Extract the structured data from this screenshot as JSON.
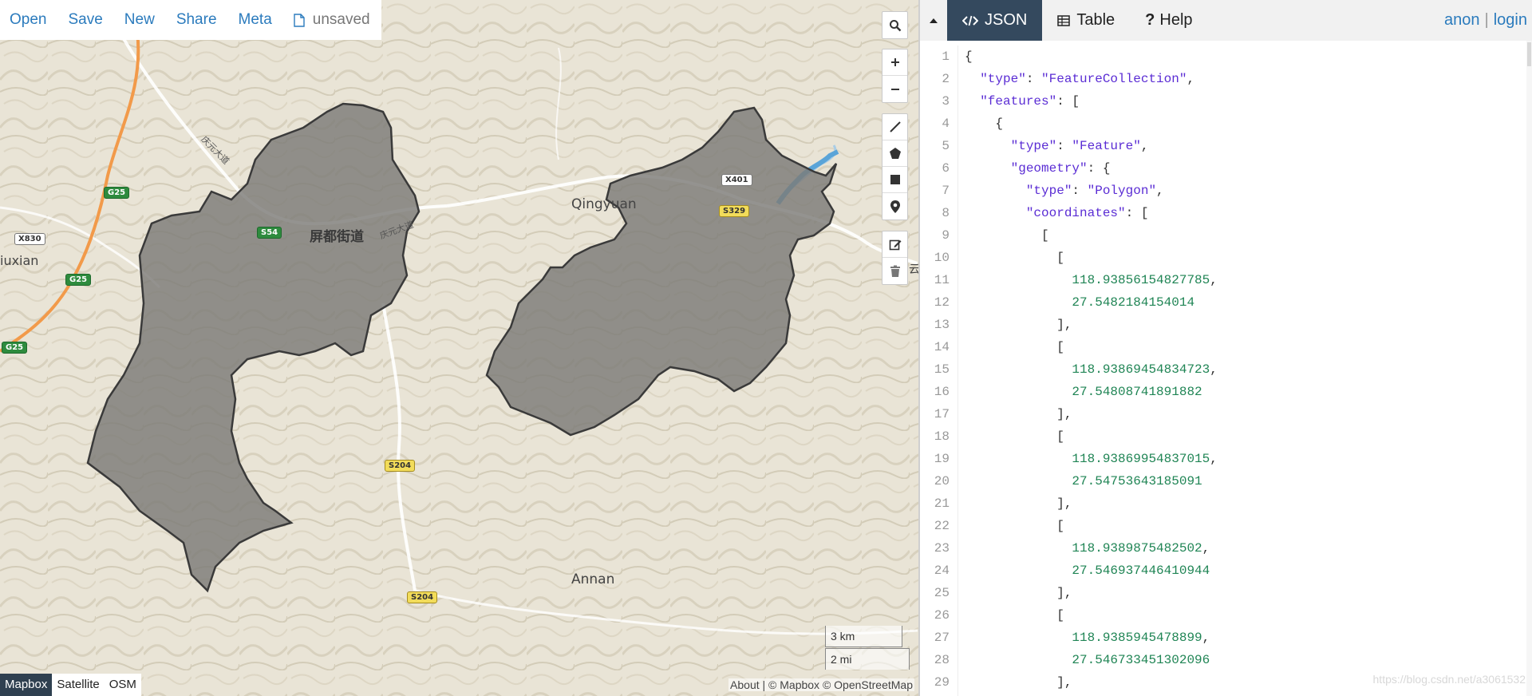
{
  "menu": {
    "open": "Open",
    "save": "Save",
    "new": "New",
    "share": "Share",
    "meta": "Meta",
    "file_status": "unsaved"
  },
  "map": {
    "labels": {
      "city_cn": "屏都街道",
      "road_cn_1": "庆元大道",
      "road_cn_2": "庆元大道",
      "qingyuan": "Qingyuan",
      "annan": "Annan",
      "liuxian": "iuxian",
      "edge_char": "云"
    },
    "shields": {
      "g25_a": "G25",
      "g25_b": "G25",
      "g25_c": "G25",
      "x830": "X830",
      "s54": "S54",
      "x401": "X401",
      "s329": "S329",
      "s204_a": "S204",
      "s204_b": "S204"
    },
    "scale": {
      "km": "3 km",
      "mi": "2 mi"
    },
    "layers": [
      {
        "label": "Mapbox",
        "active": true
      },
      {
        "label": "Satellite",
        "active": false
      },
      {
        "label": "OSM",
        "active": false
      }
    ],
    "attribution": "About | © Mapbox © OpenStreetMap",
    "colors": {
      "polygon_fill": "#7d7b77",
      "polygon_stroke": "#3a3a3a",
      "water": "#5aa4d8",
      "highway": "#f29a4a"
    }
  },
  "panel": {
    "tabs": [
      {
        "label": "JSON",
        "icon": "code-icon",
        "active": true
      },
      {
        "label": "Table",
        "icon": "table-icon",
        "active": false
      },
      {
        "label": "Help",
        "icon": "question-icon",
        "active": false
      }
    ],
    "user": {
      "anon": "anon",
      "login": "login"
    },
    "code_lines": [
      "{",
      "  \"type\": \"FeatureCollection\",",
      "  \"features\": [",
      "    {",
      "      \"type\": \"Feature\",",
      "      \"geometry\": {",
      "        \"type\": \"Polygon\",",
      "        \"coordinates\": [",
      "          [",
      "            [",
      "              118.93856154827785,",
      "              27.5482184154014",
      "            ],",
      "            [",
      "              118.93869454834723,",
      "              27.54808741891882",
      "            ],",
      "            [",
      "              118.93869954837015,",
      "              27.54753643185091",
      "            ],",
      "            [",
      "              118.9389875482502,",
      "              27.546937446410944",
      "            ],",
      "            [",
      "              118.9385945478899,",
      "              27.546733451302096",
      "            ],"
    ],
    "watermark": "https://blog.csdn.net/a3061532"
  }
}
